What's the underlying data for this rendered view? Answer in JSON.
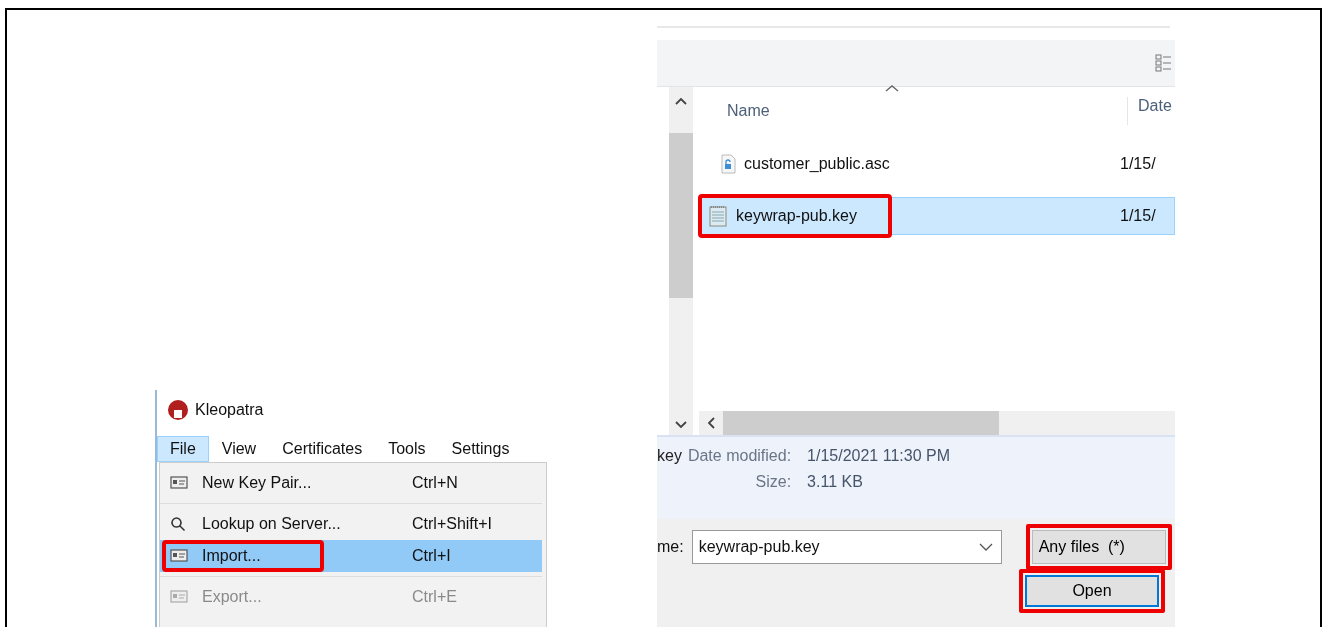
{
  "kleopatra": {
    "title": "Kleopatra",
    "menubar": [
      {
        "label": "File",
        "selected": true
      },
      {
        "label": "View",
        "selected": false
      },
      {
        "label": "Certificates",
        "selected": false
      },
      {
        "label": "Tools",
        "selected": false
      },
      {
        "label": "Settings",
        "selected": false
      }
    ],
    "file_menu": [
      {
        "kind": "certificate",
        "label": "New Key Pair...",
        "shortcut": "Ctrl+N",
        "selected": false,
        "disabled": false,
        "highlighted": false
      },
      {
        "kind": "separator"
      },
      {
        "kind": "search",
        "label": "Lookup on Server...",
        "shortcut": "Ctrl+Shift+I",
        "selected": false,
        "disabled": false,
        "highlighted": false
      },
      {
        "kind": "certificate",
        "label": "Import...",
        "shortcut": "Ctrl+I",
        "selected": true,
        "disabled": false,
        "highlighted": true
      },
      {
        "kind": "separator"
      },
      {
        "kind": "certificate",
        "label": "Export...",
        "shortcut": "Ctrl+E",
        "selected": false,
        "disabled": true,
        "highlighted": false
      }
    ]
  },
  "open_dialog": {
    "columns": [
      "Name",
      "Date"
    ],
    "files": [
      {
        "kind": "locked",
        "name": "customer_public.asc",
        "date": "1/15/",
        "selected": false,
        "highlighted": false
      },
      {
        "kind": "text",
        "name": "keywrap-pub.key",
        "date": "1/15/",
        "selected": true,
        "highlighted": true
      }
    ],
    "details": {
      "name": "key",
      "modified_label": "Date modified:",
      "modified": "1/15/2021 11:30 PM",
      "size_label": "Size:",
      "size": "3.11 KB"
    },
    "file_name_label": "me:",
    "file_name": "keywrap-pub.key",
    "file_type": {
      "label": "Any files  (*)",
      "highlighted": true
    },
    "open_button": {
      "label": "Open",
      "highlighted": true
    }
  }
}
